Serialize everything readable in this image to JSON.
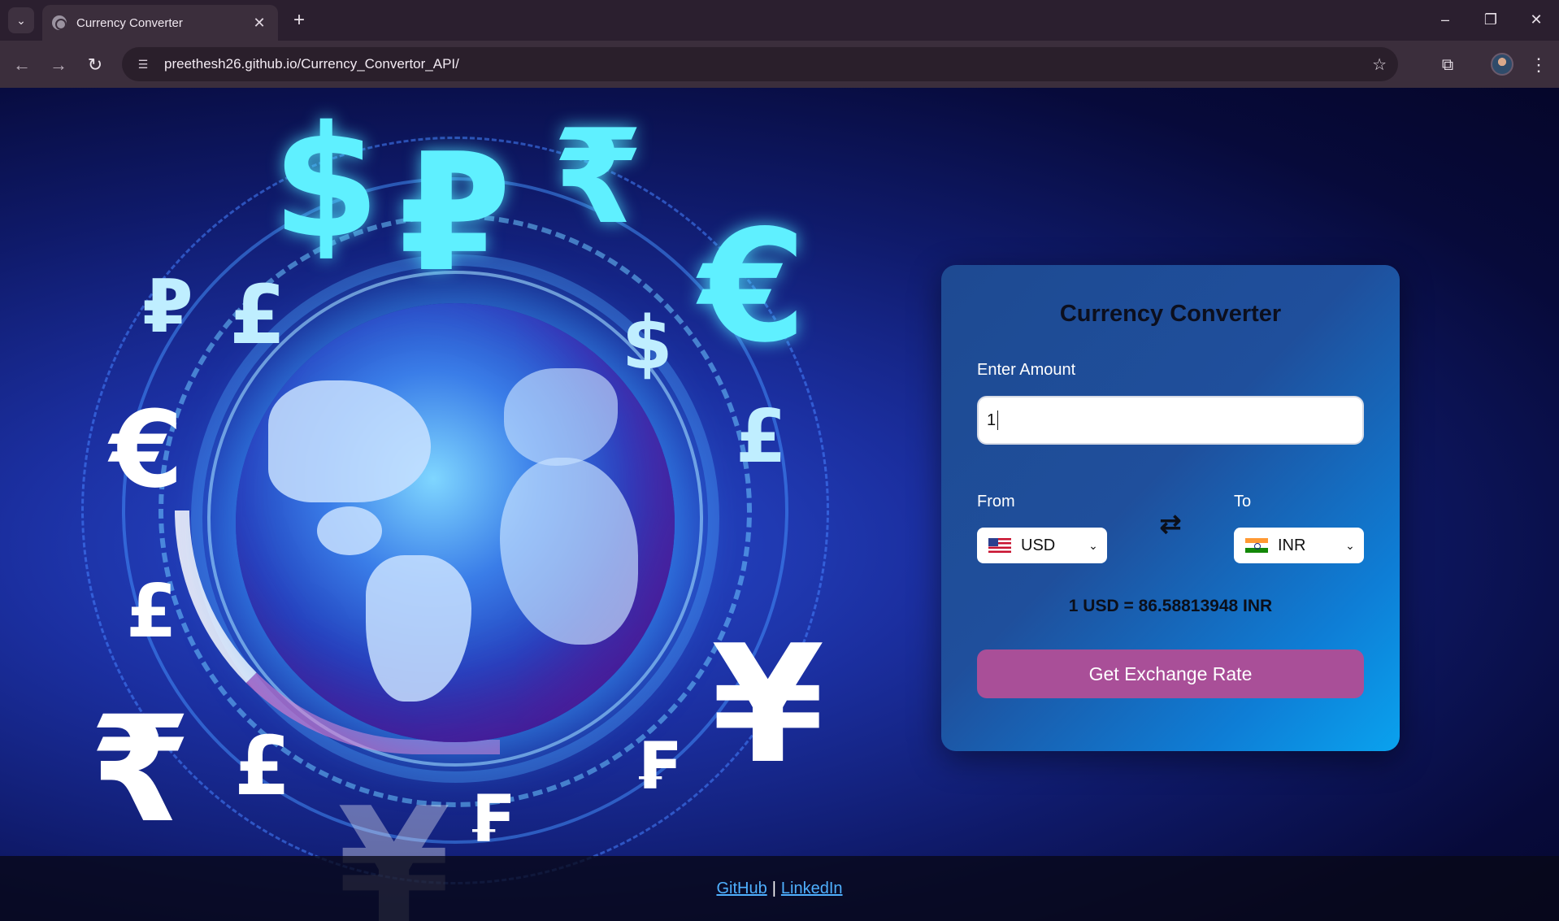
{
  "browser": {
    "tab_title": "Currency Converter",
    "url": "preethesh26.github.io/Currency_Convertor_API/",
    "icons": {
      "tab_list": "chevron-down-icon",
      "tab_close": "close-icon",
      "new_tab": "plus-icon",
      "back": "back-arrow-icon",
      "forward": "forward-arrow-icon",
      "reload": "reload-icon",
      "site_info": "site-info-icon",
      "bookmark": "star-icon",
      "extensions": "puzzle-icon",
      "menu": "kebab-menu-icon"
    }
  },
  "converter": {
    "title": "Currency Converter",
    "amount_label": "Enter Amount",
    "amount_value": "1",
    "from_label": "From",
    "to_label": "To",
    "from_currency": "USD",
    "to_currency": "INR",
    "result": "1 USD = 86.58813948 INR",
    "button_label": "Get Exchange Rate"
  },
  "footer": {
    "github": "GitHub",
    "separator": "|",
    "linkedin": "LinkedIn"
  },
  "colors": {
    "accent_button": "#a94f98",
    "link": "#4fb0ff",
    "card_gradient_start": "#1e4a92",
    "card_gradient_end": "#0aa2ee"
  }
}
